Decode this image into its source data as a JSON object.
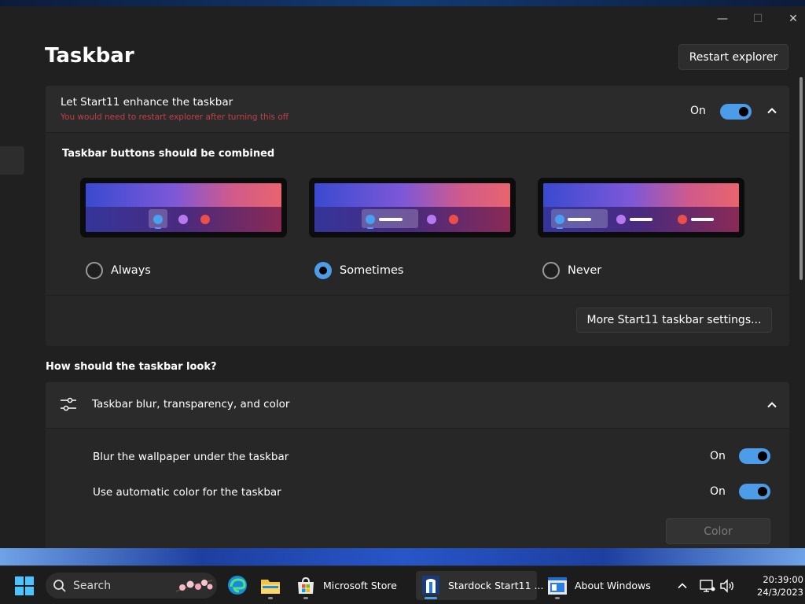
{
  "window": {
    "minimize_glyph": "—",
    "maximize_glyph": "☐",
    "close_glyph": "✕"
  },
  "page": {
    "title": "Taskbar",
    "restart_button": "Restart explorer"
  },
  "enhance": {
    "title": "Let Start11 enhance the taskbar",
    "subtitle": "You would need to restart explorer after turning this off",
    "state_label": "On",
    "toggle_on": true
  },
  "combine": {
    "title": "Taskbar buttons should be combined",
    "options": [
      {
        "label": "Always",
        "selected": false
      },
      {
        "label": "Sometimes",
        "selected": true
      },
      {
        "label": "Never",
        "selected": false
      }
    ],
    "more_button": "More Start11 taskbar settings..."
  },
  "look": {
    "heading": "How should the taskbar look?",
    "section_title": "Taskbar blur, transparency, and color",
    "settings": [
      {
        "label": "Blur the wallpaper under the taskbar",
        "state_label": "On",
        "toggle_on": true
      },
      {
        "label": "Use automatic color for the taskbar",
        "state_label": "On",
        "toggle_on": true
      }
    ],
    "color_button": "Color"
  },
  "taskbar": {
    "search_label": "Search",
    "apps": [
      {
        "name": "edge-icon",
        "label": ""
      },
      {
        "name": "file-explorer-icon",
        "label": ""
      },
      {
        "name": "microsoft-store-icon",
        "label": "Microsoft Store"
      },
      {
        "name": "stardock-start11-icon",
        "label": "Stardock Start11 ..."
      },
      {
        "name": "about-windows-icon",
        "label": "About Windows"
      }
    ],
    "clock_time": "20:39:00",
    "clock_date": "24/3/2023"
  },
  "colors": {
    "accent": "#4c9ce8",
    "warning_text": "#c0404a",
    "background": "#202020",
    "card": "#2b2b2b"
  }
}
